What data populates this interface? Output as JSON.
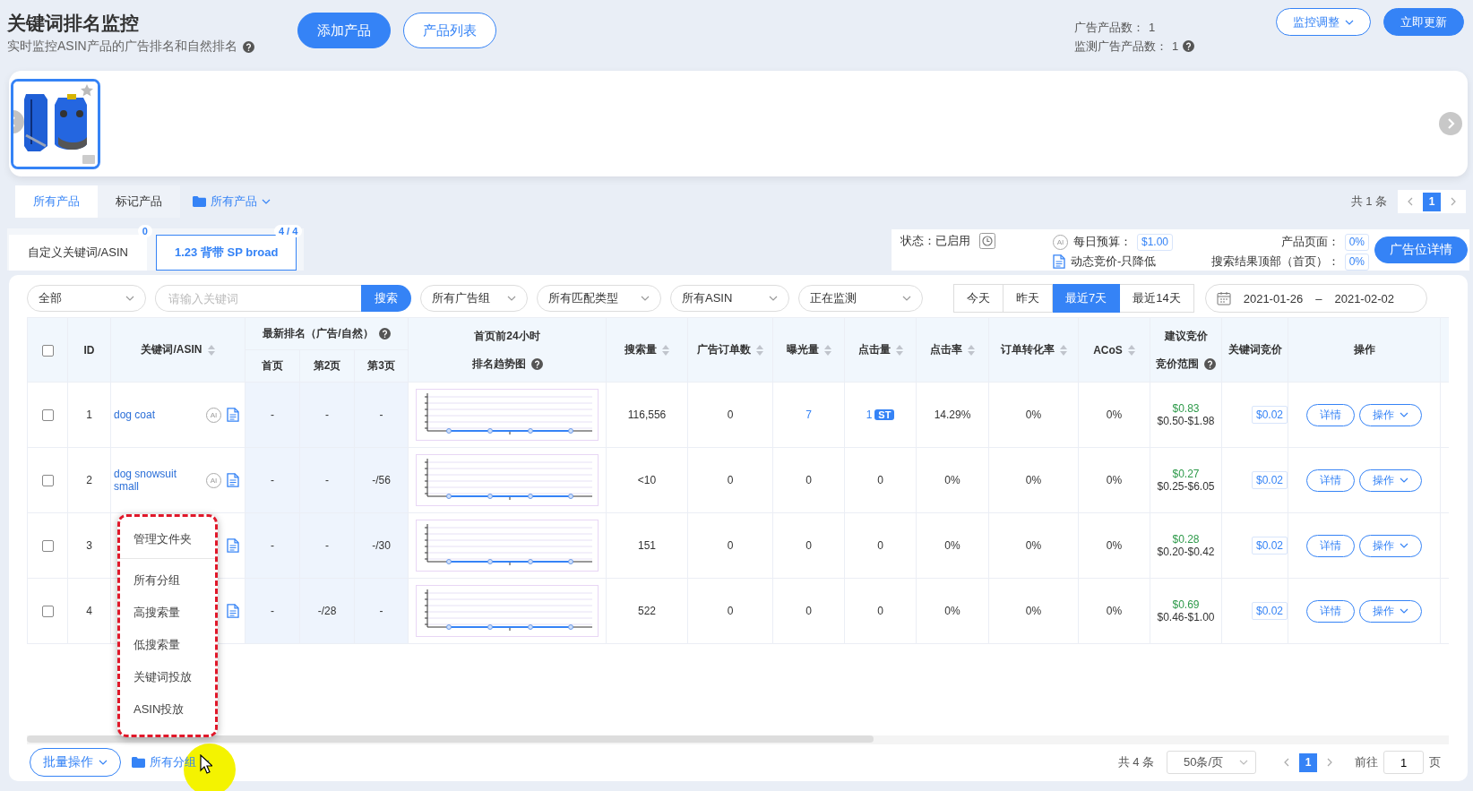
{
  "header": {
    "title": "关键词排名监控",
    "subtitle": "实时监控ASIN产品的广告排名和自然排名",
    "buttons": [
      {
        "label": "添加产品",
        "kind": "primary"
      },
      {
        "label": "产品列表",
        "kind": "outline"
      }
    ],
    "stats": [
      {
        "label": "广告产品数：",
        "value": "1",
        "help": false
      },
      {
        "label": "监测广告产品数：",
        "value": "1",
        "help": true
      }
    ],
    "actions": [
      {
        "label": "监控调整",
        "kind": "dropdown"
      },
      {
        "label": "立即更新",
        "kind": "primary"
      }
    ]
  },
  "products": [
    {
      "kind": "picture",
      "selected": true
    }
  ],
  "product_tabs": [
    {
      "label": "所有产品",
      "selected": true
    },
    {
      "label": "标记产品",
      "selected": false
    }
  ],
  "folder_filter": {
    "label": "所有产品"
  },
  "product_pager": {
    "total": "共 1 条",
    "pages": [
      {
        "label": "1",
        "selected": true
      }
    ]
  },
  "groups": [
    {
      "label": "自定义关键词/ASIN",
      "count": "0",
      "selected": false
    },
    {
      "label": "1.23 背带 SP broad",
      "count": "4 / 4",
      "selected": true
    }
  ],
  "campaign": {
    "status_label": "状态：",
    "status": "已启用",
    "ai_badge": "AI",
    "budget_label": "每日预算：",
    "budget": "$1.00",
    "bidding": "动态竞价-只降低",
    "placements": [
      {
        "label": "产品页面：",
        "value": "0%"
      },
      {
        "label": "搜索结果顶部（首页）：",
        "value": "0%"
      }
    ],
    "button": "广告位详情"
  },
  "filters": {
    "scope": "全部",
    "search_placeholder": "请输入关键词",
    "search_button": "搜索",
    "selects": [
      "所有广告组",
      "所有匹配类型",
      "所有ASIN",
      "正在监测"
    ],
    "ranges": [
      {
        "label": "今天",
        "selected": false
      },
      {
        "label": "昨天",
        "selected": false
      },
      {
        "label": "最近7天",
        "selected": true
      },
      {
        "label": "最近14天",
        "selected": false
      }
    ],
    "date_from": "2021-01-26",
    "date_sep": "–",
    "date_to": "2021-02-02"
  },
  "table": {
    "all_checked": false,
    "columns": [
      {
        "label": "ID",
        "sortable": false,
        "help": false
      },
      {
        "label": "关键词/ASIN",
        "sortable": true,
        "help": false
      },
      {
        "label": "最新排名（广告/自然）",
        "sortable": false,
        "help": true,
        "children": [
          "首页",
          "第2页",
          "第3页"
        ]
      },
      {
        "lines": [
          "首页前24小时",
          "排名趋势图"
        ],
        "sortable": false,
        "help": true
      },
      {
        "label": "搜索量",
        "sortable": true,
        "help": false
      },
      {
        "label": "广告订单数",
        "sortable": true,
        "help": false
      },
      {
        "label": "曝光量",
        "sortable": true,
        "help": false
      },
      {
        "label": "点击量",
        "sortable": true,
        "help": false
      },
      {
        "label": "点击率",
        "sortable": true,
        "help": false
      },
      {
        "label": "订单转化率",
        "sortable": true,
        "help": false
      },
      {
        "label": "ACoS",
        "sortable": true,
        "help": false
      },
      {
        "lines": [
          "建议竞价",
          "竞价范围"
        ],
        "sortable": false,
        "help": true
      },
      {
        "label": "关键词竞价",
        "sortable": false,
        "help": false
      },
      {
        "label": "操作",
        "sortable": false,
        "help": false
      }
    ],
    "rows": [
      {
        "checked": false,
        "id": "1",
        "keyword": "dog coat",
        "ai_badge": "AI",
        "ranks": [
          "-",
          "-",
          "-"
        ],
        "search_volume": "116,556",
        "orders": "0",
        "impressions": {
          "value": "7",
          "link": true
        },
        "clicks": {
          "value": "1",
          "link": true,
          "badge": "ST"
        },
        "ctr": "14.29%",
        "cvr": "0%",
        "acos": "0%",
        "suggested_bid": "$0.83",
        "bid_range": "$0.50-$1.98",
        "keyword_bid": "$0.02",
        "actions": [
          "详情",
          "操作"
        ]
      },
      {
        "checked": false,
        "id": "2",
        "keyword": "dog snowsuit small",
        "ai_badge": "AI",
        "ranks": [
          "-",
          "-",
          "-/56"
        ],
        "search_volume": "<10",
        "orders": "0",
        "impressions": {
          "value": "0",
          "link": false
        },
        "clicks": {
          "value": "0",
          "link": false
        },
        "ctr": "0%",
        "cvr": "0%",
        "acos": "0%",
        "suggested_bid": "$0.27",
        "bid_range": "$0.25-$6.05",
        "keyword_bid": "$0.02",
        "actions": [
          "详情",
          "操作"
        ]
      },
      {
        "checked": false,
        "id": "3",
        "ranks": [
          "-",
          "-",
          "-/30"
        ],
        "search_volume": "151",
        "orders": "0",
        "impressions": {
          "value": "0",
          "link": false
        },
        "clicks": {
          "value": "0",
          "link": false
        },
        "ctr": "0%",
        "cvr": "0%",
        "acos": "0%",
        "suggested_bid": "$0.28",
        "bid_range": "$0.20-$0.42",
        "keyword_bid": "$0.02",
        "actions": [
          "详情",
          "操作"
        ]
      },
      {
        "checked": false,
        "id": "4",
        "ranks": [
          "-",
          "-/28",
          "-"
        ],
        "search_volume": "522",
        "orders": "0",
        "impressions": {
          "value": "0",
          "link": false
        },
        "clicks": {
          "value": "0",
          "link": false
        },
        "ctr": "0%",
        "cvr": "0%",
        "acos": "0%",
        "suggested_bid": "$0.69",
        "bid_range": "$0.46-$1.00",
        "keyword_bid": "$0.02",
        "actions": [
          "详情",
          "操作"
        ]
      }
    ]
  },
  "group_menu": {
    "items": [
      {
        "label": "管理文件夹",
        "kind": "header"
      },
      {
        "label": "所有分组",
        "kind": "item"
      },
      {
        "label": "高搜索量",
        "kind": "item"
      },
      {
        "label": "低搜索量",
        "kind": "item"
      },
      {
        "label": "关键词投放",
        "kind": "item"
      },
      {
        "label": "ASIN投放",
        "kind": "item"
      }
    ]
  },
  "footer": {
    "batch": "批量操作",
    "group_filter": "所有分组",
    "total": "共 4 条",
    "page_size": "50条/页",
    "pages": [
      {
        "label": "1",
        "selected": true
      }
    ],
    "goto_label": "前往",
    "goto_value": "1",
    "goto_suffix": "页"
  }
}
